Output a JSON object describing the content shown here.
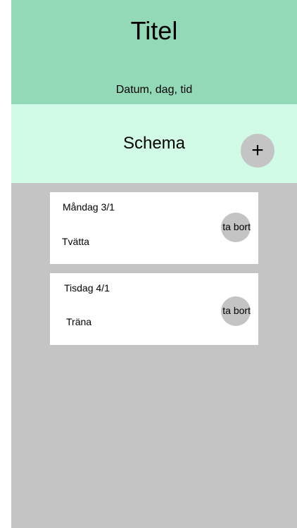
{
  "header": {
    "title": "Titel",
    "datetime": "Datum, dag, tid"
  },
  "schedule": {
    "heading": "Schema",
    "add_label": "+"
  },
  "items": [
    {
      "date": "Måndag 3/1",
      "task": "Tvätta",
      "delete_label": "ta bort"
    },
    {
      "date": "Tisdag 4/1",
      "task": "Träna",
      "delete_label": "ta bort"
    }
  ],
  "colors": {
    "header_bg": "#93d9b7",
    "schedule_bg": "#d1fbe6",
    "content_bg": "#c4c4c4",
    "card_bg": "#ffffff",
    "button_bg": "#c4c4c4"
  }
}
